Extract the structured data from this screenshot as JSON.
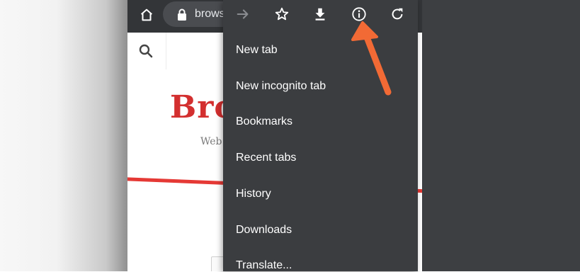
{
  "browser": {
    "url_text": "brows"
  },
  "site": {
    "logo_text": "Bro",
    "tagline_text": "Web"
  },
  "menu": {
    "toolbar_icons": [
      "forward-arrow-icon",
      "star-icon",
      "download-icon",
      "info-icon",
      "refresh-icon"
    ],
    "items": [
      {
        "label": "New tab"
      },
      {
        "label": "New incognito tab"
      },
      {
        "label": "Bookmarks"
      },
      {
        "label": "Recent tabs"
      },
      {
        "label": "History"
      },
      {
        "label": "Downloads"
      },
      {
        "label": "Translate..."
      }
    ]
  },
  "colors": {
    "menu_bg": "#3b3d40",
    "toolbar_bg": "#333538",
    "logo_red": "#d32f2f",
    "annotation_arrow": "#f26a35"
  }
}
